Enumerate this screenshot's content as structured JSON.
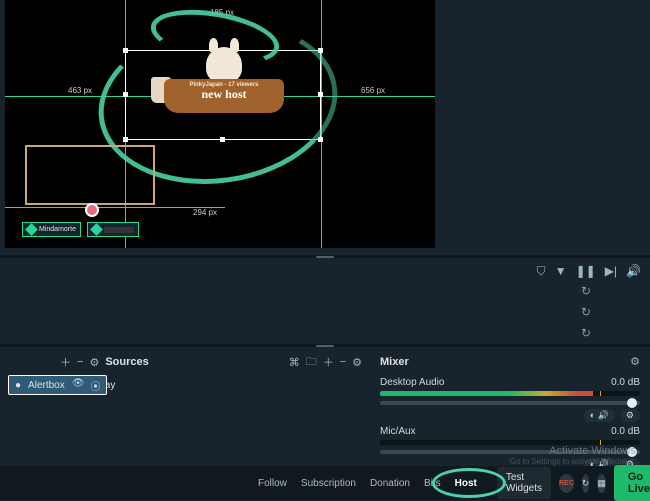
{
  "rulers": {
    "top": "185 px",
    "left": "463 px",
    "right": "656 px",
    "bottom": "294 px"
  },
  "alert": {
    "line1": "PinkyJapan - 17 viewers",
    "line2": "new host"
  },
  "chip1": "Mindamorte",
  "sources": {
    "title": "Sources",
    "items": [
      {
        "icon": "●",
        "label": "Alertbox",
        "selected": true
      },
      {
        "icon": "▥",
        "label": "Live Overlay",
        "selected": false,
        "indent": true,
        "chev": "›"
      }
    ]
  },
  "mixer": {
    "title": "Mixer",
    "channels": [
      {
        "name": "Desktop Audio",
        "db": "0.0 dB",
        "level": 82
      },
      {
        "name": "Mic/Aux",
        "db": "0.0 dB",
        "level": 0
      }
    ]
  },
  "tabs": [
    "Follow",
    "Subscription",
    "Donation",
    "Bits",
    "Host"
  ],
  "active_tab": "Host",
  "test_label": "Test Widgets",
  "go_live": "Go Live",
  "rec": "REC",
  "watermark": {
    "t": "Activate Windows",
    "s": "Go to Settings to activate Windows."
  }
}
